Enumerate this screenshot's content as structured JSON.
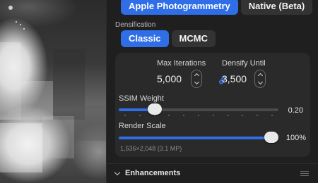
{
  "mode": {
    "options": [
      "Apple Photogrammetry",
      "Native (Beta)"
    ],
    "selected": "Apple Photogrammetry"
  },
  "densification": {
    "label": "Densification",
    "options": [
      "Classic",
      "MCMC"
    ],
    "selected": "Classic"
  },
  "fields": {
    "max_iterations": {
      "label": "Max Iterations",
      "value": "5,000"
    },
    "densify_until": {
      "label": "Densify Until",
      "value": "3,500"
    }
  },
  "ssim": {
    "label": "SSIM Weight",
    "value_text": "0.20",
    "fraction": 0.2
  },
  "render_scale": {
    "label": "Render Scale",
    "value_text": "100%",
    "fraction": 1.0
  },
  "resolution_text": "1,536×2,048 (3.1 MP)",
  "enhancements": {
    "label": "Enhancements"
  },
  "colors": {
    "accent": "#2f6ee6",
    "panel": "#1f1f1f",
    "card": "#2a2a2a"
  },
  "icons": [
    "chain-link-icon",
    "chevron-up-icon",
    "chevron-down-icon",
    "drag-handle-icon"
  ]
}
